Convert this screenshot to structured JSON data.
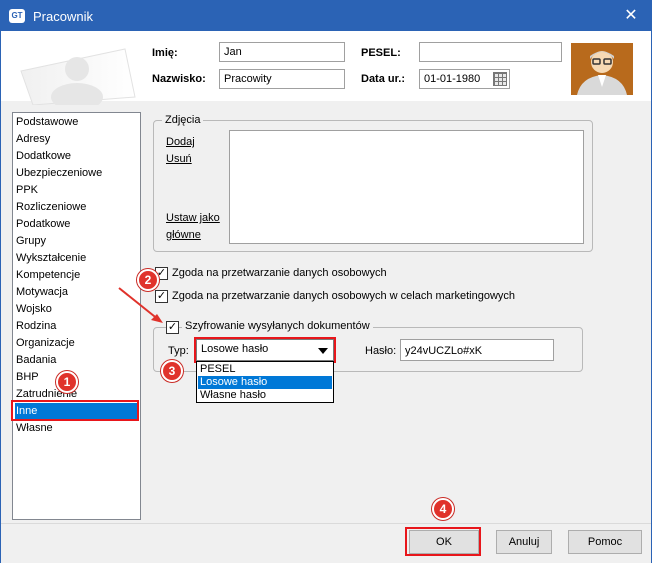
{
  "window": {
    "title": "Pracownik",
    "icon_text": "GT",
    "close_glyph": "✕"
  },
  "header": {
    "imie_label": "Imię:",
    "imie_value": "Jan",
    "nazwisko_label": "Nazwisko:",
    "nazwisko_value": "Pracowity",
    "pesel_label": "PESEL:",
    "pesel_value": "",
    "data_ur_label": "Data ur.:",
    "data_ur_value": "01-01-1980"
  },
  "sidebar": {
    "items": [
      "Podstawowe",
      "Adresy",
      "Dodatkowe",
      "Ubezpieczeniowe",
      "PPK",
      "Rozliczeniowe",
      "Podatkowe",
      "Grupy",
      "Wykształcenie",
      "Kompetencje",
      "Motywacja",
      "Wojsko",
      "Rodzina",
      "Organizacje",
      "Badania",
      "BHP",
      "Zatrudnienie",
      "Inne",
      "Własne"
    ],
    "selected": "Inne"
  },
  "photos_group": {
    "title": "Zdjęcia",
    "add_link": "Dodaj",
    "remove_link": "Usuń",
    "set_main_link_1": "Ustaw jako",
    "set_main_link_2": "główne"
  },
  "consents": {
    "consent_1": "Zgoda na przetwarzanie danych osobowych",
    "consent_2": "Zgoda na przetwarzanie danych osobowych w celach marketingowych",
    "check_glyph": "✓"
  },
  "encryption": {
    "title": "Szyfrowanie wysyłanych dokumentów",
    "type_label": "Typ:",
    "type_value": "Losowe hasło",
    "password_label": "Hasło:",
    "password_value": "y24vUCZLo#xK",
    "options": [
      "PESEL",
      "Losowe hasło",
      "Własne hasło"
    ],
    "selected_option": "Losowe hasło"
  },
  "buttons": {
    "ok": "OK",
    "cancel": "Anuluj",
    "help": "Pomoc"
  },
  "badges": [
    "1",
    "2",
    "3",
    "4"
  ],
  "colors": {
    "titlebar": "#2b63b5",
    "selection": "#0078d7",
    "highlight": "#e8161b"
  }
}
